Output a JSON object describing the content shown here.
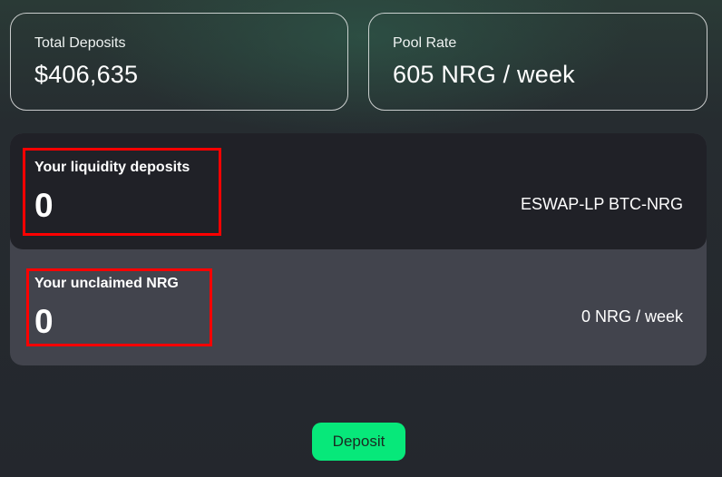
{
  "stats": {
    "total_deposits": {
      "label": "Total Deposits",
      "value": "$406,635"
    },
    "pool_rate": {
      "label": "Pool Rate",
      "value": "605 NRG / week"
    }
  },
  "liquidity": {
    "label": "Your liquidity deposits",
    "value": "0",
    "token": "ESWAP-LP BTC-NRG"
  },
  "unclaimed": {
    "label": "Your unclaimed NRG",
    "value": "0",
    "rate": "0 NRG / week"
  },
  "actions": {
    "deposit_label": "Deposit"
  },
  "colors": {
    "accent": "#07e87a",
    "highlight": "#ff0000",
    "panel_dark": "#202127",
    "panel_light": "#42444d"
  }
}
